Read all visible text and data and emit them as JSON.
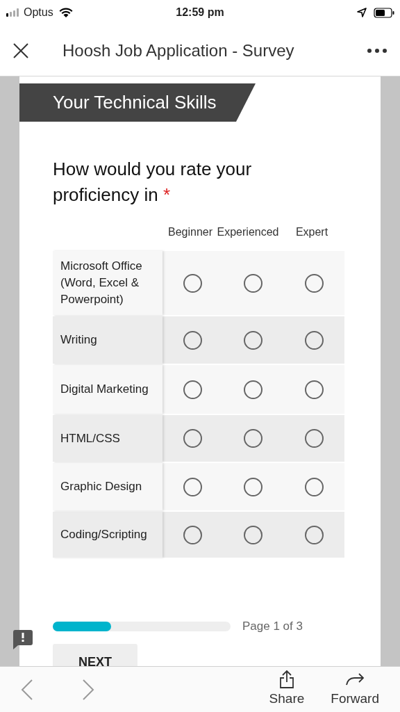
{
  "status_bar": {
    "carrier": "Optus",
    "time": "12:59 pm"
  },
  "header": {
    "title": "Hoosh Job Application - Survey"
  },
  "section": {
    "title": "Your Technical Skills"
  },
  "question": {
    "text": "How would you rate your proficiency in",
    "required_mark": "*"
  },
  "columns": [
    "Beginner",
    "Experienced",
    "Expert"
  ],
  "rows": [
    {
      "label": "Microsoft Office (Word, Excel & Powerpoint)",
      "options": [
        {
          "selected": false
        },
        {
          "selected": false
        },
        {
          "selected": false
        }
      ]
    },
    {
      "label": "Writing",
      "options": [
        {
          "selected": false
        },
        {
          "selected": false
        },
        {
          "selected": false
        }
      ]
    },
    {
      "label": "Digital Marketing",
      "options": [
        {
          "selected": false
        },
        {
          "selected": false
        },
        {
          "selected": false
        }
      ]
    },
    {
      "label": "HTML/CSS",
      "options": [
        {
          "selected": false
        },
        {
          "selected": false
        },
        {
          "selected": false
        }
      ]
    },
    {
      "label": "Graphic Design",
      "options": [
        {
          "selected": false
        },
        {
          "selected": false
        },
        {
          "selected": false
        }
      ]
    },
    {
      "label": "Coding/Scripting",
      "options": [
        {
          "selected": false
        },
        {
          "selected": false
        },
        {
          "selected": false
        }
      ]
    }
  ],
  "progress": {
    "level": 0.33,
    "label": "Page 1 of 3"
  },
  "next_button": "NEXT",
  "toolbar": {
    "share": "Share",
    "forward": "Forward"
  }
}
